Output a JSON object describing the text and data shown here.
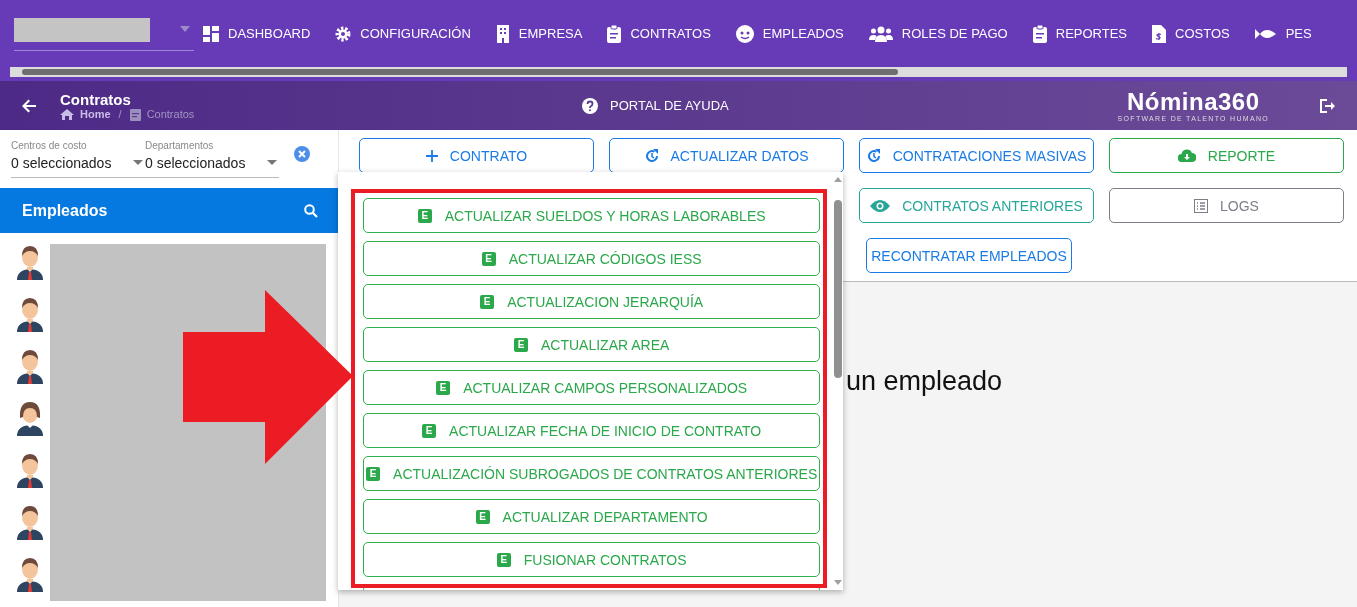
{
  "nav": {
    "items": [
      {
        "label": "DASHBOARD"
      },
      {
        "label": "CONFIGURACIÓN"
      },
      {
        "label": "EMPRESA"
      },
      {
        "label": "CONTRATOS"
      },
      {
        "label": "EMPLEADOS"
      },
      {
        "label": "ROLES DE PAGO"
      },
      {
        "label": "REPORTES"
      },
      {
        "label": "COSTOS"
      },
      {
        "label": "PES"
      }
    ]
  },
  "header": {
    "title": "Contratos",
    "breadcrumb": [
      {
        "label": "Home",
        "current": false
      },
      {
        "label": "Contratos",
        "current": true
      }
    ],
    "separator": "/",
    "help": "PORTAL DE AYUDA",
    "logo": {
      "name": "Nómina360",
      "tagline": "SOFTWARE DE TALENTO HUMANO"
    }
  },
  "filters": [
    {
      "label": "Centros de costo",
      "value": "0 seleccionados"
    },
    {
      "label": "Departamentos",
      "value": "0 seleccionados"
    }
  ],
  "employees": {
    "title": "Empleados"
  },
  "actions": [
    {
      "label": "CONTRATO",
      "kind": "primary"
    },
    {
      "label": "ACTUALIZAR DATOS",
      "kind": "primary"
    },
    {
      "label": "CONTRATACIONES MASIVAS",
      "kind": "primary"
    },
    {
      "label": "REPORTE",
      "kind": "success"
    },
    {
      "label": "CONTRATOS ANTERIORES",
      "kind": "info"
    },
    {
      "label": "LOGS",
      "kind": "secondary"
    },
    {
      "label": "RECONTRATAR EMPLEADOS",
      "kind": "primary"
    }
  ],
  "empty_message": "un empleado",
  "dropdown": {
    "items": [
      {
        "label": "ACTUALIZAR SUELDOS Y HORAS LABORABLES",
        "badge": "E"
      },
      {
        "label": "ACTUALIZAR CÓDIGOS IESS",
        "badge": "E"
      },
      {
        "label": "ACTUALIZACION JERARQUÍA",
        "badge": "E"
      },
      {
        "label": "ACTUALIZAR AREA",
        "badge": "E"
      },
      {
        "label": "ACTUALIZAR CAMPOS PERSONALIZADOS",
        "badge": "E"
      },
      {
        "label": "ACTUALIZAR FECHA DE INICIO DE CONTRATO",
        "badge": "E"
      },
      {
        "label": "ACTUALIZACIÓN SUBROGADOS DE CONTRATOS ANTERIORES",
        "badge": "E"
      },
      {
        "label": "ACTUALIZAR DEPARTAMENTO",
        "badge": "E"
      },
      {
        "label": "FUSIONAR CONTRATOS",
        "badge": "E"
      }
    ]
  }
}
